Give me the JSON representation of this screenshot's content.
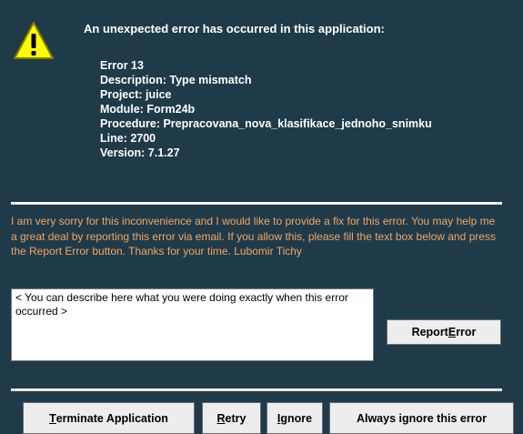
{
  "headline": "An unexpected error has occurred in this application:",
  "details": [
    "Error 13",
    "Description: Type mismatch",
    "Project: juice",
    "Module: Form24b",
    "Procedure: Prepracovana_nova_klasifikace_jednoho_snimku",
    "Line: 2700",
    "Version: 7.1.27"
  ],
  "message": "I am very sorry for this inconvenience and I would like to provide a fix for this error. You may help me a great deal by reporting this error via email. If you allow this, please fill the text box below and press the Report Error button. Thanks for your time. Lubomir Tichy",
  "description_box": {
    "value": "< You can describe here what you were doing exactly when this error occurred >"
  },
  "buttons": {
    "report": {
      "pre": "Report ",
      "key": "E",
      "post": "rror"
    },
    "terminate": {
      "pre": "",
      "key": "T",
      "post": "erminate Application"
    },
    "retry": {
      "pre": "",
      "key": "R",
      "post": "etry"
    },
    "ignore": {
      "pre": "",
      "key": "I",
      "post": "gnore"
    },
    "always_ignore": {
      "pre": "Always i",
      "key": "g",
      "post": "nore this error"
    }
  },
  "colors": {
    "background": "#1f3b4a",
    "message_text": "#f4a460",
    "warning_fill": "#ffff00"
  }
}
